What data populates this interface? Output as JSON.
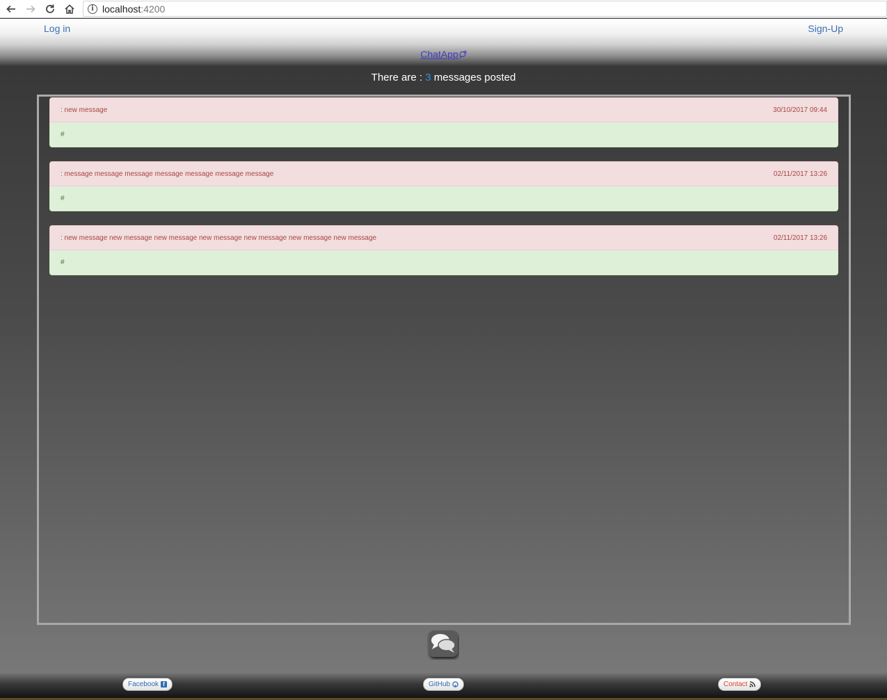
{
  "browser": {
    "url_host": "localhost",
    "url_port": ":4200",
    "info_icon": "i"
  },
  "header": {
    "login": "Log in",
    "signup": "Sign-Up",
    "brand": "ChatApp"
  },
  "counter": {
    "prefix": "There are : ",
    "count": "3",
    "suffix": " messages posted"
  },
  "messages": [
    {
      "text": ": new message",
      "date": "30/10/2017 09:44",
      "author": "#"
    },
    {
      "text": ": message message message message message message message",
      "date": "02/11/2017 13:26",
      "author": "#"
    },
    {
      "text": ": new message new message new message new message new message new message new message",
      "date": "02/11/2017 13:26",
      "author": "#"
    }
  ],
  "footer": {
    "facebook": "Facebook",
    "github": "GitHub",
    "contact": "Contact",
    "facebook_glyph": "f"
  },
  "colors": {
    "link": "#3a6fb5",
    "counter_accent": "#2f8fe0",
    "message_head_bg": "#f2dede",
    "message_body_bg": "#dff0d8"
  },
  "icons": [
    "back-arrow-icon",
    "forward-arrow-icon",
    "reload-icon",
    "home-icon",
    "info-icon",
    "chat-bubbles-icon",
    "facebook-icon",
    "github-icon",
    "rss-icon"
  ]
}
